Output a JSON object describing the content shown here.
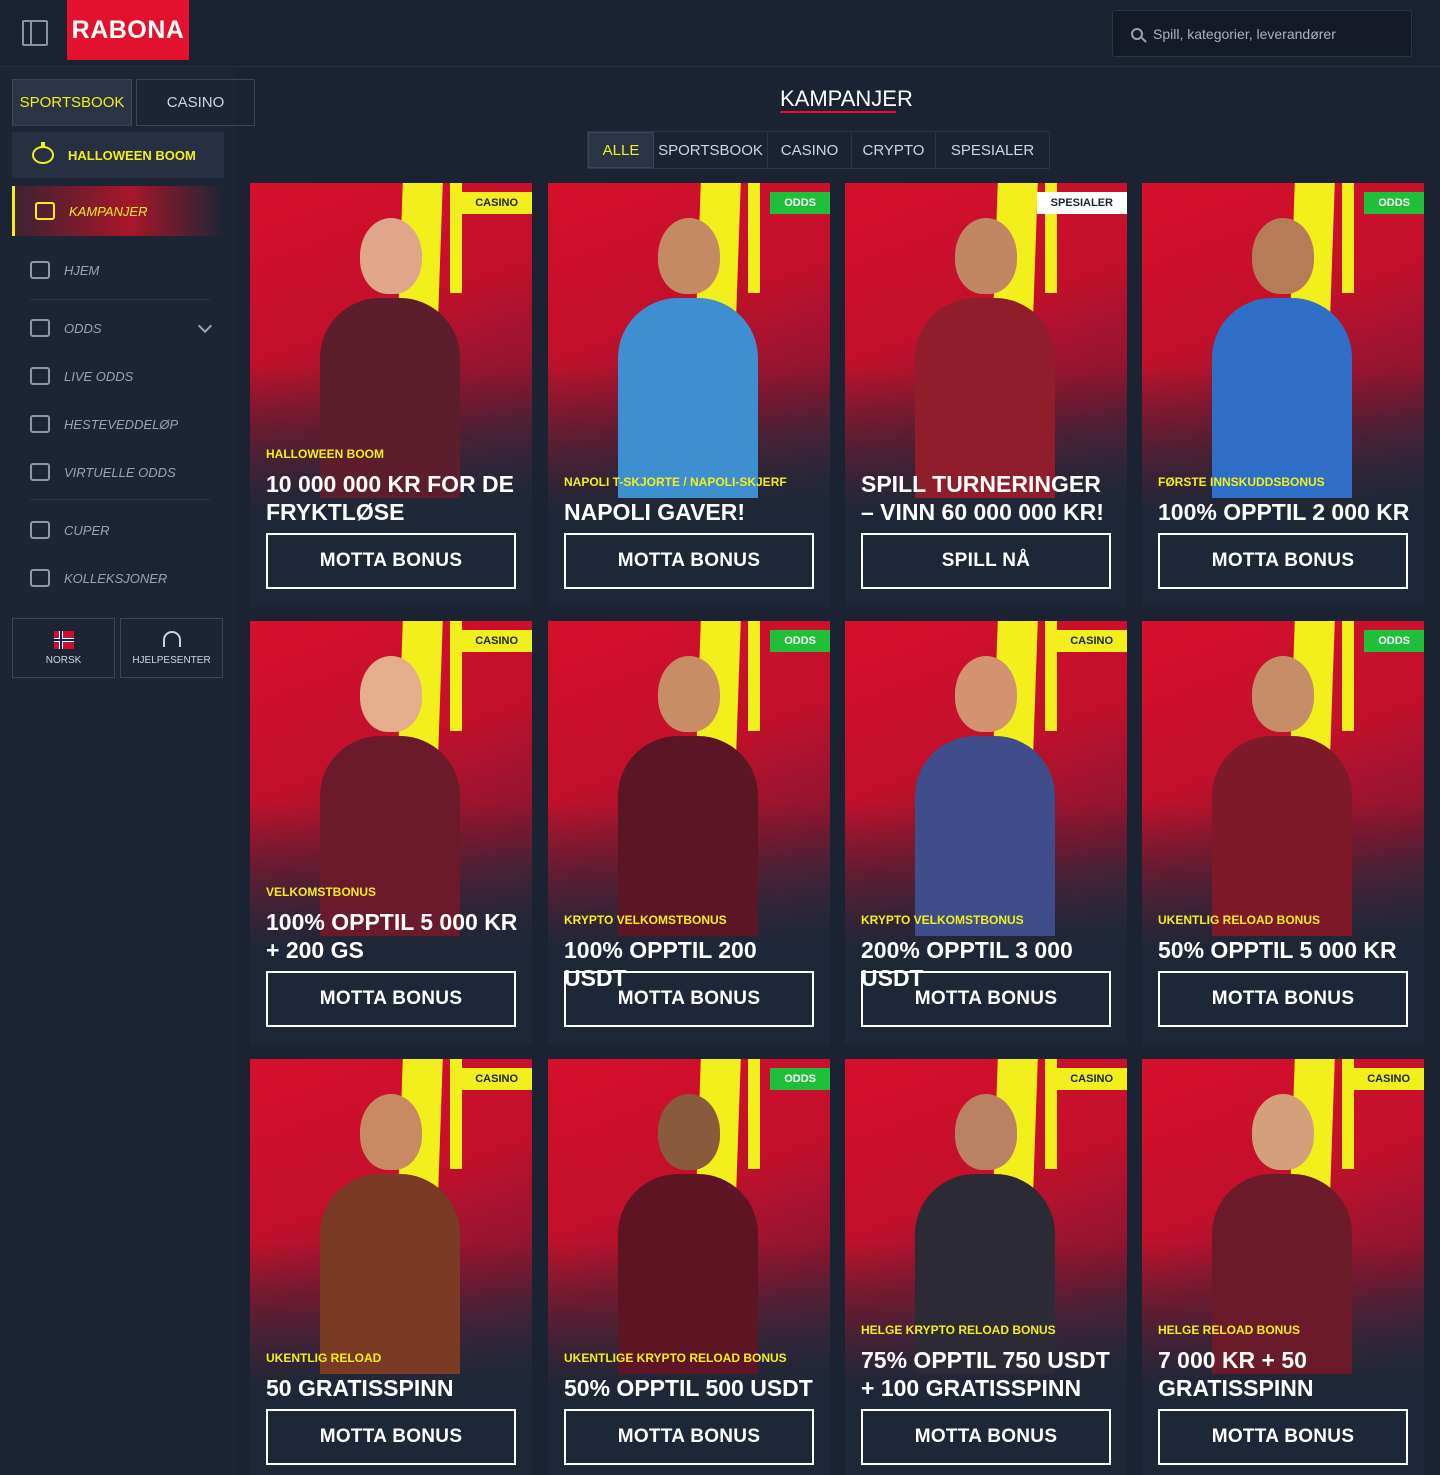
{
  "header": {
    "logo": "RABONA",
    "search_placeholder": "Spill, kategorier, leverandører"
  },
  "sidebar": {
    "mode_tabs": [
      "SPORTSBOOK",
      "CASINO"
    ],
    "halloween": "HALLOWEEN BOOM",
    "active_item": "KAMPANJER",
    "items": [
      "HJEM",
      "ODDS",
      "LIVE ODDS",
      "HESTEVEDDELØP",
      "VIRTUELLE ODDS",
      "CUPER",
      "KOLLEKSJONER"
    ],
    "language": "NORSK",
    "help": "HJELPESENTER"
  },
  "main": {
    "title": "KAMPANJER",
    "filters": [
      "ALLE",
      "SPORTSBOOK",
      "CASINO",
      "CRYPTO",
      "SPESIALER"
    ]
  },
  "cards": [
    {
      "badge": "CASINO",
      "sub": "HALLOWEEN BOOM",
      "title": "10 000 000 KR FOR DE FRYKTLØSE",
      "button": "MOTTA BONUS",
      "skin": "#e0a68a",
      "outfit": "#5c1d2c"
    },
    {
      "badge": "ODDS",
      "sub": "NAPOLI T-SKJORTE / NAPOLI-SKJERF",
      "title": "NAPOLI GAVER!",
      "button": "MOTTA BONUS",
      "skin": "#c48a64",
      "outfit": "#3d8fd0"
    },
    {
      "badge": "SPESIALER",
      "sub": "",
      "title": "SPILL TURNERINGER – VINN 60 000 000 KR!",
      "button": "SPILL NÅ",
      "skin": "#c08762",
      "outfit": "#8f1d2a"
    },
    {
      "badge": "ODDS",
      "sub": "FØRSTE INNSKUDDSBONUS",
      "title": "100% OPPTIL 2 000 KR",
      "button": "MOTTA BONUS",
      "skin": "#b67c58",
      "outfit": "#2f6fc7"
    },
    {
      "badge": "CASINO",
      "sub": "VELKOMSTBONUS",
      "title": "100% OPPTIL 5 000 KR + 200 GS",
      "button": "MOTTA BONUS",
      "skin": "#e4ad8c",
      "outfit": "#6a1a2b"
    },
    {
      "badge": "ODDS",
      "sub": "KRYPTO VELKOMSTBONUS",
      "title": "100% OPPTIL 200 USDT",
      "button": "MOTTA BONUS",
      "skin": "#c68d67",
      "outfit": "#5a1625"
    },
    {
      "badge": "CASINO",
      "sub": "KRYPTO VELKOMSTBONUS",
      "title": "200% OPPTIL 3 000 USDT",
      "button": "MOTTA BONUS",
      "skin": "#d49370",
      "outfit": "#3f4d8a"
    },
    {
      "badge": "ODDS",
      "sub": "UKENTLIG RELOAD BONUS",
      "title": "50% OPPTIL 5 000 KR",
      "button": "MOTTA BONUS",
      "skin": "#c58d68",
      "outfit": "#7d1928"
    },
    {
      "badge": "CASINO",
      "sub": "UKENTLIG RELOAD",
      "title": "50 GRATISSPINN",
      "button": "MOTTA BONUS",
      "skin": "#c88a62",
      "outfit": "#7a3a24"
    },
    {
      "badge": "ODDS",
      "sub": "UKENTLIGE KRYPTO RELOAD BONUS",
      "title": "50% OPPTIL 500 USDT",
      "button": "MOTTA BONUS",
      "skin": "#8a5a3c",
      "outfit": "#5d1524"
    },
    {
      "badge": "CASINO",
      "sub": "HELGE KRYPTO RELOAD BONUS",
      "title": "75% OPPTIL 750 USDT + 100 GRATISSPINN",
      "button": "MOTTA BONUS",
      "skin": "#b98363",
      "outfit": "#2c2a35"
    },
    {
      "badge": "CASINO",
      "sub": "HELGE RELOAD BONUS",
      "title": "7 000 KR + 50 GRATISSPINN",
      "button": "MOTTA BONUS",
      "skin": "#d4a07c",
      "outfit": "#6a1a28"
    }
  ],
  "colors": {
    "accent_yellow": "#f2ef1c",
    "brand_red": "#e3102e",
    "bg": "#1b2332"
  }
}
